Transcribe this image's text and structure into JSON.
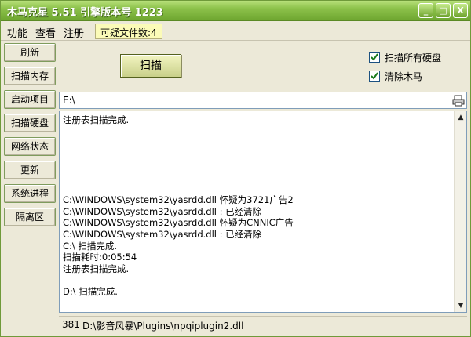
{
  "window": {
    "title": "木马克星 5.51 引擎版本号 1223",
    "minimize_label": "_",
    "maximize_label": "□",
    "close_label": "X"
  },
  "menu": {
    "items": [
      "功能",
      "查看",
      "注册"
    ],
    "file_count": "可疑文件数:4"
  },
  "sidebar": {
    "items": [
      "刷新",
      "扫描内存",
      "启动项目",
      "扫描硬盘",
      "网络状态",
      "更新",
      "系统进程",
      "隔离区"
    ]
  },
  "toolbar": {
    "scan_label": "扫描"
  },
  "options": {
    "scan_all_drives": {
      "label": "扫描所有硬盘",
      "checked": true
    },
    "remove_trojans": {
      "label": "清除木马",
      "checked": true
    }
  },
  "path": {
    "value": "E:\\"
  },
  "log": {
    "lines": [
      "注册表扫描完成.",
      "",
      "",
      "",
      "",
      "",
      "",
      "C:\\WINDOWS\\system32\\yasrdd.dll 怀疑为3721广告2",
      "C:\\WINDOWS\\system32\\yasrdd.dll : 已经清除",
      "C:\\WINDOWS\\system32\\yasrdd.dll 怀疑为CNNIC广告",
      "C:\\WINDOWS\\system32\\yasrdd.dll : 已经清除",
      "C:\\ 扫描完成.",
      "扫描耗时:0:05:54",
      "注册表扫描完成.",
      "",
      "D:\\ 扫描完成."
    ]
  },
  "status": {
    "count": "381",
    "current_file": "D:\\影音风暴\\Plugins\\npqiplugin2.dll"
  },
  "colors": {
    "titlebar": "#8cc14a",
    "highlight": "#fbfbb8"
  }
}
